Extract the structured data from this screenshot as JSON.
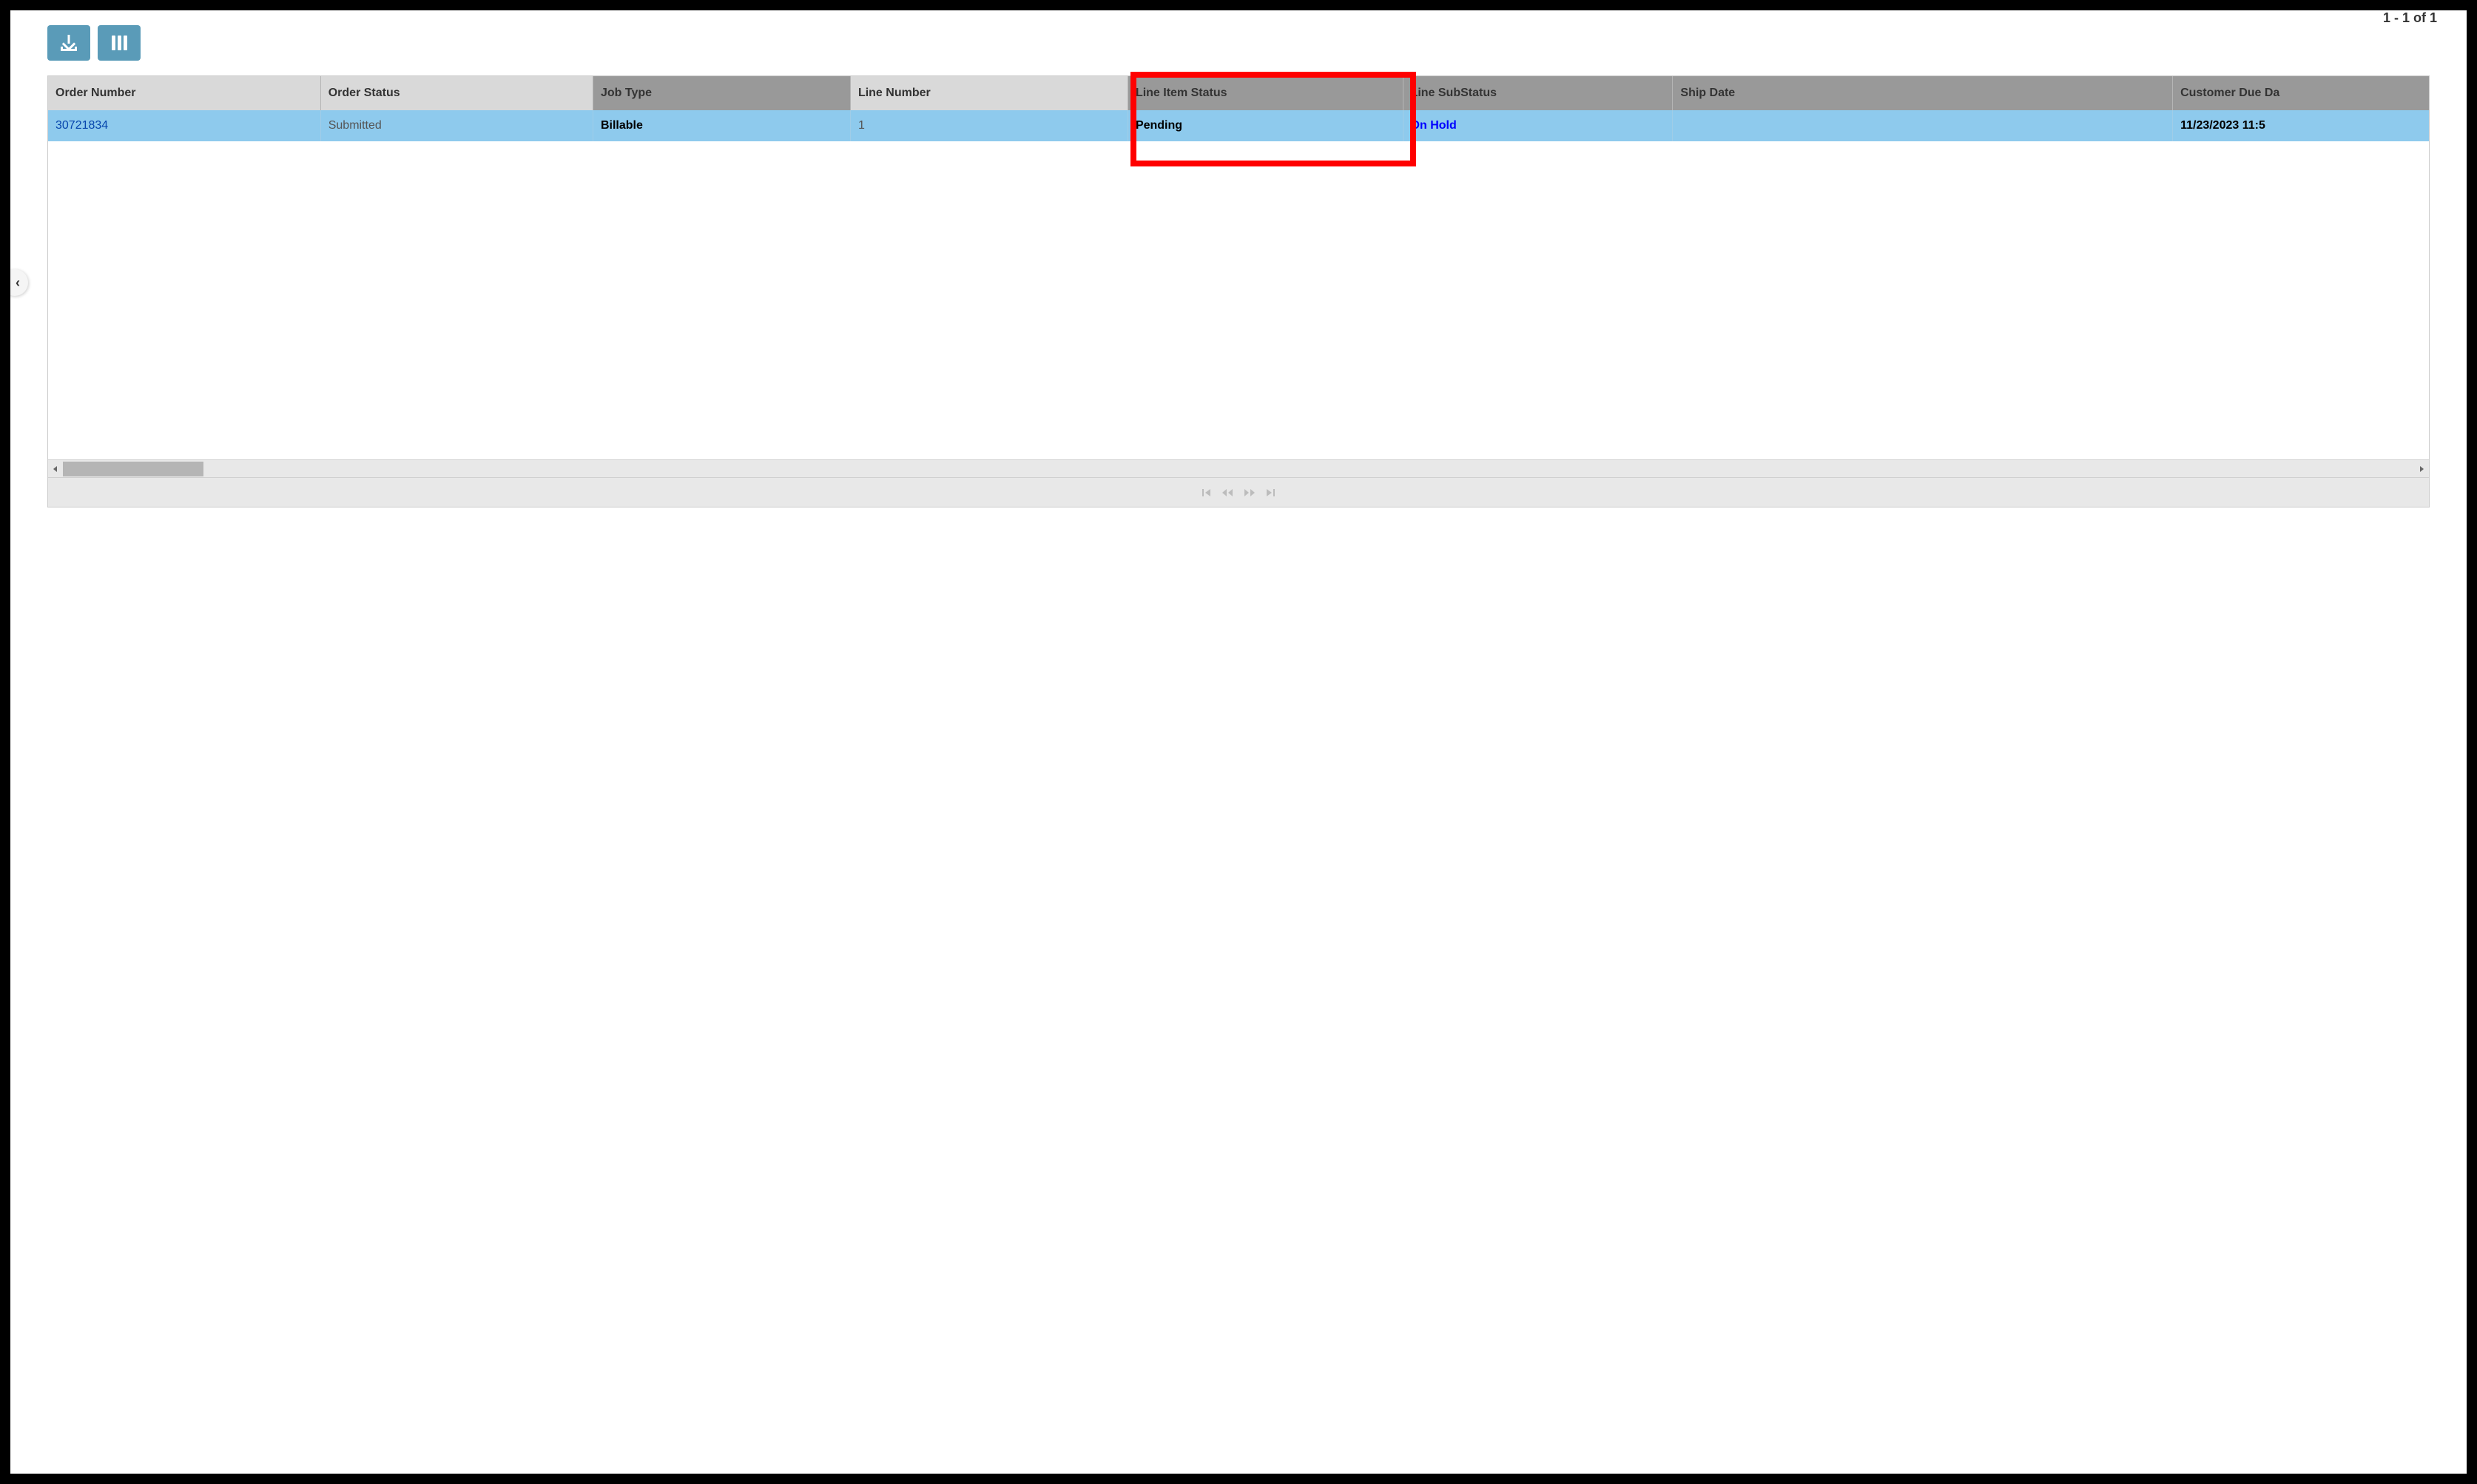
{
  "pagination": {
    "counter": "1 - 1 of 1"
  },
  "toolbar": {
    "download_label": "download",
    "columns_label": "columns"
  },
  "grid": {
    "headers": [
      {
        "label": "Order Number",
        "style": "light",
        "width": "10.9%"
      },
      {
        "label": "Order Status",
        "style": "light",
        "width": "10.9%"
      },
      {
        "label": "Job Type",
        "style": "dark",
        "width": "10.3%"
      },
      {
        "label": "Line Number",
        "style": "light",
        "width": "11.1%"
      },
      {
        "label": "Line Item Status",
        "style": "dark",
        "width": "11.0%"
      },
      {
        "label": "Line SubStatus",
        "style": "dark",
        "width": "10.8%"
      },
      {
        "label": "Ship Date",
        "style": "dark",
        "width": "20.0%"
      },
      {
        "label": "Customer Due Da",
        "style": "dark",
        "width": "15.0%"
      }
    ],
    "rows": [
      {
        "order_number": "30721834",
        "order_status": "Submitted",
        "job_type": "Billable",
        "line_number": "1",
        "line_item_status": "Pending",
        "line_substatus": "On Hold",
        "ship_date": "",
        "customer_due_date": "11/23/2023 11:5"
      }
    ]
  },
  "highlight": {
    "target_column": "Line Item Status"
  }
}
